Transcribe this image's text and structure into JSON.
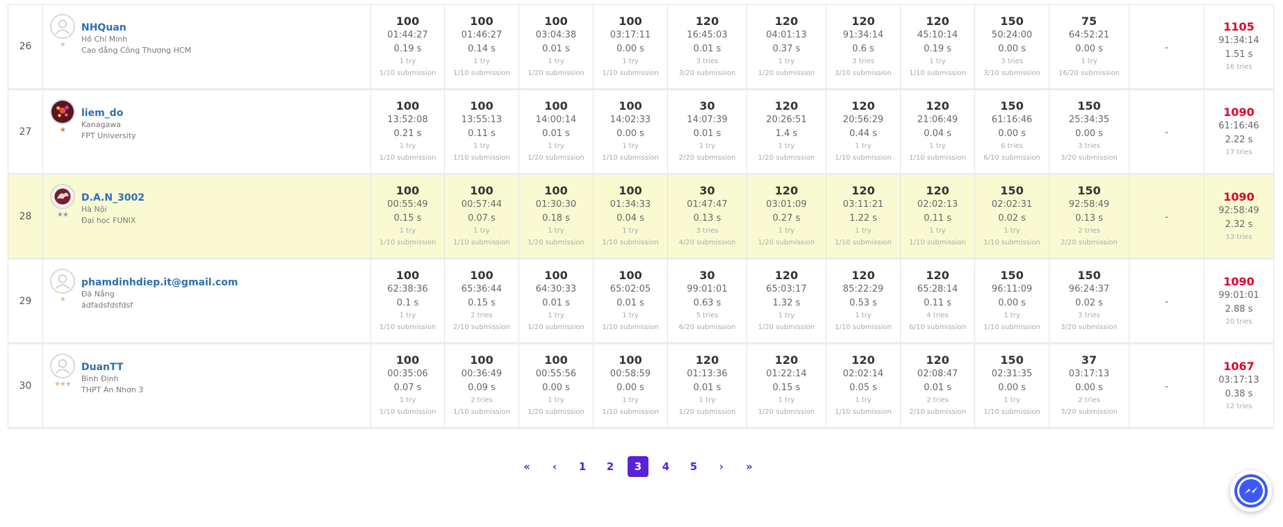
{
  "colors": {
    "accent": "#5b21d6",
    "total": "#e0002a",
    "username": "#2f6fb3",
    "highlight_row": "#fafad2"
  },
  "rows": [
    {
      "rank": "26",
      "username": "NHQuan",
      "location": "Hồ Chí Minh",
      "organization": "Cao đẳng Công Thương HCM",
      "stars": "★",
      "star_color": "#c8c8c8",
      "avatar": "default-avatar-icon",
      "highlight": false,
      "problems": [
        {
          "score": "100",
          "time": "01:44:27",
          "exec": "0.19 s",
          "tries": "1 try",
          "subs": "1/10 submission"
        },
        {
          "score": "100",
          "time": "01:46:27",
          "exec": "0.14 s",
          "tries": "1 try",
          "subs": "1/10 submission"
        },
        {
          "score": "100",
          "time": "03:04:38",
          "exec": "0.01 s",
          "tries": "1 try",
          "subs": "1/20 submission"
        },
        {
          "score": "100",
          "time": "03:17:11",
          "exec": "0.00 s",
          "tries": "1 try",
          "subs": "1/10 submission"
        },
        {
          "score": "120",
          "time": "16:45:03",
          "exec": "0.01 s",
          "tries": "3 tries",
          "subs": "3/20 submission"
        },
        {
          "score": "120",
          "time": "04:01:13",
          "exec": "0.37 s",
          "tries": "1 try",
          "subs": "1/20 submission"
        },
        {
          "score": "120",
          "time": "91:34:14",
          "exec": "0.6 s",
          "tries": "3 tries",
          "subs": "3/10 submission"
        },
        {
          "score": "120",
          "time": "45:10:14",
          "exec": "0.19 s",
          "tries": "1 try",
          "subs": "1/10 submission"
        },
        {
          "score": "150",
          "time": "50:24:00",
          "exec": "0.00 s",
          "tries": "3 tries",
          "subs": "3/10 submission"
        },
        {
          "score": "75",
          "time": "64:52:21",
          "exec": "0.00 s",
          "tries": "1 try",
          "subs": "16/20 submission"
        }
      ],
      "extra": "-",
      "total": {
        "score": "1105",
        "time": "91:34:14",
        "exec": "1.51 s",
        "tries": "16 tries"
      }
    },
    {
      "rank": "27",
      "username": "liem_do",
      "location": "Kanagawa",
      "organization": "FPT University",
      "stars": "★",
      "star_color": "#e8742a",
      "avatar": "firework-avatar-icon",
      "highlight": false,
      "problems": [
        {
          "score": "100",
          "time": "13:52:08",
          "exec": "0.21 s",
          "tries": "1 try",
          "subs": "1/10 submission"
        },
        {
          "score": "100",
          "time": "13:55:13",
          "exec": "0.11 s",
          "tries": "1 try",
          "subs": "1/10 submission"
        },
        {
          "score": "100",
          "time": "14:00:14",
          "exec": "0.01 s",
          "tries": "1 try",
          "subs": "1/20 submission"
        },
        {
          "score": "100",
          "time": "14:02:33",
          "exec": "0.00 s",
          "tries": "1 try",
          "subs": "1/10 submission"
        },
        {
          "score": "30",
          "time": "14:07:39",
          "exec": "0.01 s",
          "tries": "1 try",
          "subs": "2/20 submission"
        },
        {
          "score": "120",
          "time": "20:26:51",
          "exec": "1.4 s",
          "tries": "1 try",
          "subs": "1/20 submission"
        },
        {
          "score": "120",
          "time": "20:56:29",
          "exec": "0.44 s",
          "tries": "1 try",
          "subs": "1/10 submission"
        },
        {
          "score": "120",
          "time": "21:06:49",
          "exec": "0.04 s",
          "tries": "1 try",
          "subs": "1/10 submission"
        },
        {
          "score": "150",
          "time": "61:16:46",
          "exec": "0.00 s",
          "tries": "6 tries",
          "subs": "6/10 submission"
        },
        {
          "score": "150",
          "time": "25:34:35",
          "exec": "0.00 s",
          "tries": "3 tries",
          "subs": "3/20 submission"
        }
      ],
      "extra": "-",
      "total": {
        "score": "1090",
        "time": "61:16:46",
        "exec": "2.22 s",
        "tries": "17 tries"
      }
    },
    {
      "rank": "28",
      "username": "D.A.N_3002",
      "location": "Hà Nội",
      "organization": "Đại học FUNIX",
      "stars": "★★",
      "star_color": "#8a9bb0",
      "avatar": "dragon-avatar-icon",
      "highlight": true,
      "problems": [
        {
          "score": "100",
          "time": "00:55:49",
          "exec": "0.15 s",
          "tries": "1 try",
          "subs": "1/10 submission"
        },
        {
          "score": "100",
          "time": "00:57:44",
          "exec": "0.07 s",
          "tries": "1 try",
          "subs": "1/10 submission"
        },
        {
          "score": "100",
          "time": "01:30:30",
          "exec": "0.18 s",
          "tries": "1 try",
          "subs": "1/20 submission"
        },
        {
          "score": "100",
          "time": "01:34:33",
          "exec": "0.04 s",
          "tries": "1 try",
          "subs": "1/10 submission"
        },
        {
          "score": "30",
          "time": "01:47:47",
          "exec": "0.13 s",
          "tries": "3 tries",
          "subs": "4/20 submission"
        },
        {
          "score": "120",
          "time": "03:01:09",
          "exec": "0.27 s",
          "tries": "1 try",
          "subs": "1/20 submission"
        },
        {
          "score": "120",
          "time": "03:11:21",
          "exec": "1.22 s",
          "tries": "1 try",
          "subs": "1/10 submission"
        },
        {
          "score": "120",
          "time": "02:02:13",
          "exec": "0.11 s",
          "tries": "1 try",
          "subs": "1/10 submission"
        },
        {
          "score": "150",
          "time": "02:02:31",
          "exec": "0.02 s",
          "tries": "1 try",
          "subs": "1/10 submission"
        },
        {
          "score": "150",
          "time": "92:58:49",
          "exec": "0.13 s",
          "tries": "2 tries",
          "subs": "2/20 submission"
        }
      ],
      "extra": "-",
      "total": {
        "score": "1090",
        "time": "92:58:49",
        "exec": "2.32 s",
        "tries": "13 tries"
      }
    },
    {
      "rank": "29",
      "username": "phamdinhdiep.it@gmail.com",
      "location": "Đà Nẵng",
      "organization": "ádfadsfdsfdsf",
      "stars": "★",
      "star_color": "#e9b98f",
      "avatar": "default-avatar-icon",
      "highlight": false,
      "problems": [
        {
          "score": "100",
          "time": "62:38:36",
          "exec": "0.1 s",
          "tries": "1 try",
          "subs": "1/10 submission"
        },
        {
          "score": "100",
          "time": "65:36:44",
          "exec": "0.15 s",
          "tries": "2 tries",
          "subs": "2/10 submission"
        },
        {
          "score": "100",
          "time": "64:30:33",
          "exec": "0.01 s",
          "tries": "1 try",
          "subs": "1/20 submission"
        },
        {
          "score": "100",
          "time": "65:02:05",
          "exec": "0.01 s",
          "tries": "1 try",
          "subs": "1/10 submission"
        },
        {
          "score": "30",
          "time": "99:01:01",
          "exec": "0.63 s",
          "tries": "5 tries",
          "subs": "6/20 submission"
        },
        {
          "score": "120",
          "time": "65:03:17",
          "exec": "1.32 s",
          "tries": "1 try",
          "subs": "1/20 submission"
        },
        {
          "score": "120",
          "time": "85:22:29",
          "exec": "0.53 s",
          "tries": "1 try",
          "subs": "1/10 submission"
        },
        {
          "score": "120",
          "time": "65:28:14",
          "exec": "0.11 s",
          "tries": "4 tries",
          "subs": "6/10 submission"
        },
        {
          "score": "150",
          "time": "96:11:09",
          "exec": "0.00 s",
          "tries": "1 try",
          "subs": "1/10 submission"
        },
        {
          "score": "150",
          "time": "96:24:37",
          "exec": "0.02 s",
          "tries": "3 tries",
          "subs": "3/20 submission"
        }
      ],
      "extra": "-",
      "total": {
        "score": "1090",
        "time": "99:01:01",
        "exec": "2.88 s",
        "tries": "20 tries"
      }
    },
    {
      "rank": "30",
      "username": "DuanTT",
      "location": "Bình Định",
      "organization": "THPT An Nhơn 3",
      "stars": "★★★",
      "star_color": "#e9b98f",
      "avatar": "default-avatar-icon",
      "highlight": false,
      "problems": [
        {
          "score": "100",
          "time": "00:35:06",
          "exec": "0.07 s",
          "tries": "1 try",
          "subs": "1/10 submission"
        },
        {
          "score": "100",
          "time": "00:36:49",
          "exec": "0.09 s",
          "tries": "2 tries",
          "subs": "1/10 submission"
        },
        {
          "score": "100",
          "time": "00:55:56",
          "exec": "0.00 s",
          "tries": "1 try",
          "subs": "1/20 submission"
        },
        {
          "score": "100",
          "time": "00:58:59",
          "exec": "0.00 s",
          "tries": "1 try",
          "subs": "1/10 submission"
        },
        {
          "score": "120",
          "time": "01:13:36",
          "exec": "0.01 s",
          "tries": "1 try",
          "subs": "1/20 submission"
        },
        {
          "score": "120",
          "time": "01:22:14",
          "exec": "0.15 s",
          "tries": "1 try",
          "subs": "1/20 submission"
        },
        {
          "score": "120",
          "time": "02:02:14",
          "exec": "0.05 s",
          "tries": "1 try",
          "subs": "1/10 submission"
        },
        {
          "score": "120",
          "time": "02:08:47",
          "exec": "0.01 s",
          "tries": "2 tries",
          "subs": "2/10 submission"
        },
        {
          "score": "150",
          "time": "02:31:35",
          "exec": "0.00 s",
          "tries": "1 try",
          "subs": "1/10 submission"
        },
        {
          "score": "37",
          "time": "03:17:13",
          "exec": "0.00 s",
          "tries": "2 tries",
          "subs": "3/20 submission"
        }
      ],
      "extra": "-",
      "total": {
        "score": "1067",
        "time": "03:17:13",
        "exec": "0.38 s",
        "tries": "12 tries"
      }
    }
  ],
  "pagination": {
    "first": "«",
    "prev": "‹",
    "pages": [
      "1",
      "2",
      "3",
      "4",
      "5"
    ],
    "current": "3",
    "next": "›",
    "last": "»"
  },
  "messenger": {
    "icon": "messenger-icon"
  }
}
